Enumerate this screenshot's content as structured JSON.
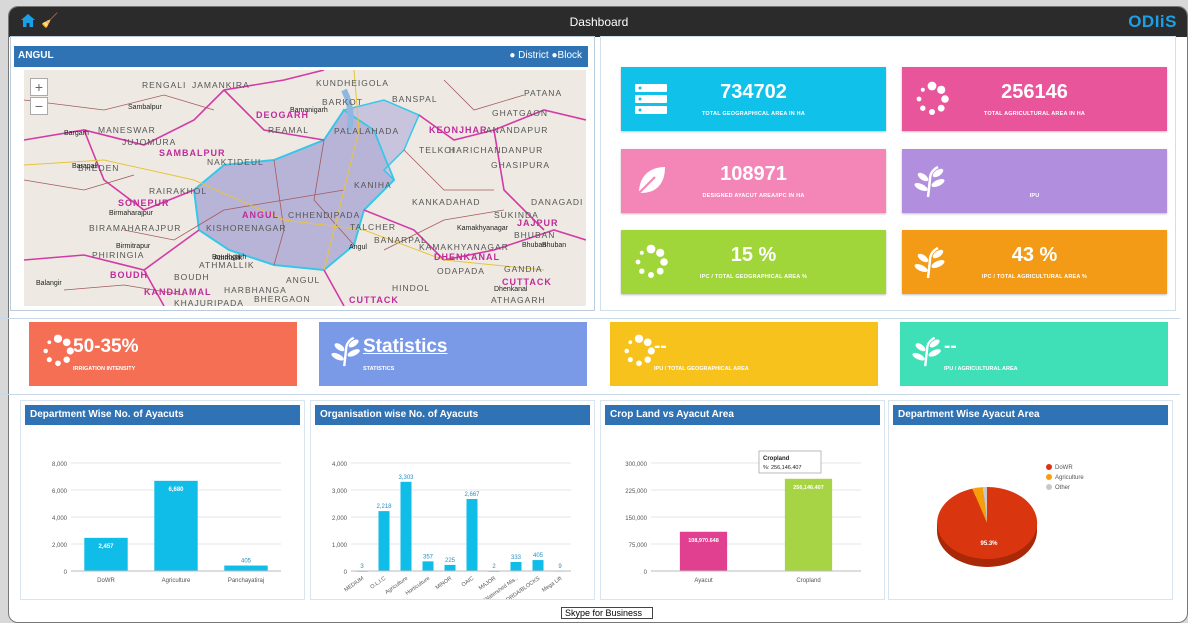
{
  "header": {
    "title": "Dashboard",
    "logo": "ODIiS",
    "home_icon": "home-icon",
    "clear_icon": "broom-icon"
  },
  "map": {
    "title": "ANGUL",
    "options": [
      "District",
      "Block"
    ],
    "zoom_in": "+",
    "zoom_out": "−",
    "district_labels": [
      "DEOGARH",
      "SAMBALPUR",
      "KEONJHAR",
      "SONEPUR",
      "ANGUL",
      "JAJPUR",
      "DHENKANAL",
      "BOUDH",
      "KANDHAMAL",
      "CUTTACK",
      "CUTTACK"
    ],
    "block_labels": [
      "RENGALI",
      "JAMANKIRA",
      "KUNDHEIGOLA",
      "REAMAL",
      "PALALAHADA",
      "BANSPAL",
      "GHATGAON",
      "ANANDAPUR",
      "BARKOT",
      "PATANA",
      "MANESWAR",
      "JUJOMURA",
      "NAKTIDEUL",
      "TELKOI",
      "HARICHANDANPUR",
      "GHASIPURA",
      "BHEDEN",
      "RAIRAKHOL",
      "KANIHA",
      "KANKADAHAD",
      "DANAGADI",
      "BIRAMAHARAJPUR",
      "KISHORENAGAR",
      "CHHENDIPADA",
      "TALCHER",
      "SUKINDA",
      "BHUBAN",
      "ATHMALLIK",
      "BANARPAL",
      "KAMAKHYANAGAR",
      "HINDOL",
      "GANDIA",
      "BOUDH",
      "ODAPADA",
      "ATHAGARH",
      "KHAJURIPADA",
      "PHIRINGIA",
      "BHERGAON",
      "ANGUL",
      "HARBHANGA"
    ],
    "town_labels": [
      "Barapali",
      "Bargarh",
      "Sambalpur",
      "Birmaharajpur",
      "Kamakhyanagar",
      "Bhuban",
      "Bamanigarh",
      "Dhenkanal",
      "Balangir",
      "Birmitrapur",
      "Angul",
      "Athmallik",
      "Boudhgarh",
      "Bhuban"
    ]
  },
  "kpis": [
    {
      "value": "734702",
      "label": "TOTAL GEOGRAPHICAL AREA IN HA",
      "color": "#10c1ea",
      "icon": "server-icon"
    },
    {
      "value": "256146",
      "label": "TOTAL AGRICULTURAL AREA IN HA",
      "color": "#e9559a",
      "icon": "spinner-icon"
    },
    {
      "value": "108971",
      "label": "DESIGNED AYACUT AREA/IPC IN HA",
      "color": "#f485b7",
      "icon": "leaf-icon"
    },
    {
      "value": "",
      "label": "IPU",
      "color": "#b28fde",
      "icon": "plant-icon"
    },
    {
      "value": "15 %",
      "label": "IPC / TOTAL GEOGRAPHICAL AREA %",
      "color": "#a1d63a",
      "icon": "spinner-icon"
    },
    {
      "value": "43 %",
      "label": "IPC / TOTAL AGRICULTURAL AREA %",
      "color": "#f39b16",
      "icon": "plant-icon"
    }
  ],
  "wide_tiles": [
    {
      "value": "50-35%",
      "label": "IRRIGATION INTENSITY",
      "color": "#f56f55",
      "icon": "spinner-icon"
    },
    {
      "value": "Statistics",
      "label": "STATISTICS",
      "color": "#7a9ae8",
      "icon": "plant-icon"
    },
    {
      "value": "--",
      "label": "IPU / TOTAL GEOGRAPHICAL AREA",
      "color": "#f8c21d",
      "icon": "spinner-icon"
    },
    {
      "value": "--",
      "label": "IPU / AGRICULTURAL AREA",
      "color": "#3fe0b8",
      "icon": "plant-icon"
    }
  ],
  "chart_data": [
    {
      "type": "bar",
      "title": "Department Wise No. of Ayacuts",
      "categories": [
        "DoWR",
        "Agriculture",
        "Panchayatiraj"
      ],
      "values": [
        2457,
        6680,
        405
      ],
      "ylim": [
        0,
        8000
      ],
      "yticks": [
        "0",
        "2,000",
        "4,000",
        "6,000",
        "8,000"
      ],
      "data_labels": [
        "2,457",
        "6,680",
        "405"
      ],
      "color": "#10bde8"
    },
    {
      "type": "bar",
      "title": "Organisation wise No. of Ayacuts",
      "categories": [
        "MEDIUM",
        "O.L.I.C",
        "Agriculture",
        "Horticulture",
        "MINOR",
        "OAIC",
        "MAJOR",
        "Watershed Mis..",
        "DRDA/BLOCKS",
        "Mega Lift"
      ],
      "values": [
        3,
        2218,
        3303,
        357,
        225,
        2667,
        2,
        333,
        405,
        9
      ],
      "ylim": [
        0,
        4000
      ],
      "yticks": [
        "0",
        "1,000",
        "2,000",
        "3,000",
        "4,000"
      ],
      "data_labels": [
        "3",
        "2,218",
        "3,303",
        "357",
        "225",
        "2,667",
        "2",
        "333",
        "405",
        "9"
      ],
      "color": "#10bde8"
    },
    {
      "type": "bar",
      "title": "Crop Land vs Ayacut Area",
      "categories": [
        "Ayacut",
        "Cropland"
      ],
      "values": [
        108970.648,
        256146.407
      ],
      "ylim": [
        0,
        300000
      ],
      "yticks": [
        "0",
        "75,000",
        "150,000",
        "225,000",
        "300,000"
      ],
      "data_labels": [
        "108,970.648",
        "256,146.407"
      ],
      "colors": [
        "#e0408f",
        "#a6d445"
      ],
      "tooltip": {
        "title": "Cropland",
        "text": "%: 256,146.407"
      }
    },
    {
      "type": "pie",
      "title": "Department Wise Ayacut Area",
      "categories": [
        "DoWR",
        "Agriculture",
        "Other"
      ],
      "values": [
        95.3,
        3.4,
        1.3
      ],
      "data_labels": [
        "95.3%"
      ],
      "colors": [
        "#d9350f",
        "#f5a00a",
        "#c8c8c8"
      ],
      "legend": "right"
    }
  ],
  "taskbar_tooltip": "Skype for Business"
}
